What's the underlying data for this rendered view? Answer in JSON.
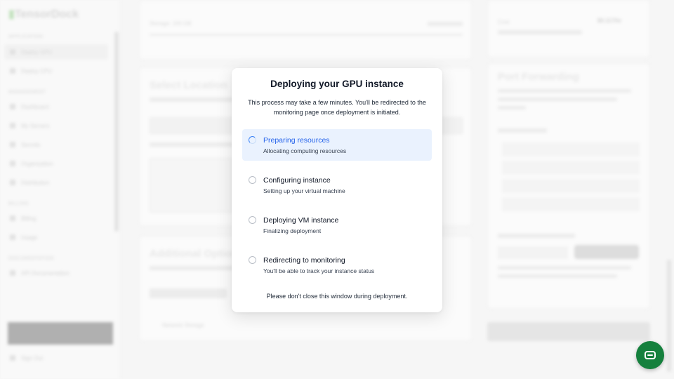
{
  "background": {
    "brand": "TensorDock",
    "sidebar": {
      "sections": [
        "APPLICATION",
        "MANAGEMENT",
        "BILLING",
        "DOCUMENTATION"
      ],
      "items": [
        "Deploy GPU",
        "Deploy CPU",
        "Dashboard",
        "My Servers",
        "Secrets",
        "Organization",
        "Distribution",
        "Billing",
        "Usage",
        "API Documentation"
      ],
      "sign_out": "Sign Out"
    },
    "storage_label": "Storage: 100 GB",
    "section_location": "Select Location",
    "section_options": "Additional Options",
    "section_ports": "Port Forwarding",
    "network_storage_label": "Network Storage",
    "cost_label": "Cost",
    "cost_value": "$0.117/hr"
  },
  "modal": {
    "title": "Deploying your GPU instance",
    "description": "This process may take a few minutes. You'll be redirected to the monitoring page once deployment is initiated.",
    "steps": [
      {
        "title": "Preparing resources",
        "subtitle": "Allocating computing resources",
        "status": "active"
      },
      {
        "title": "Configuring instance",
        "subtitle": "Setting up your virtual machine",
        "status": "pending"
      },
      {
        "title": "Deploying VM instance",
        "subtitle": "Finalizing deployment",
        "status": "pending"
      },
      {
        "title": "Redirecting to monitoring",
        "subtitle": "You'll be able to track your instance status",
        "status": "pending"
      }
    ],
    "footer": "Please don't close this window during deployment."
  },
  "colors": {
    "accent": "#2563eb",
    "active_step_bg": "#eaf2fe",
    "chat_button": "#15803d"
  },
  "icons": {
    "active_step": "spinner-icon",
    "pending_step": "circle-icon",
    "chat": "chat-icon"
  }
}
